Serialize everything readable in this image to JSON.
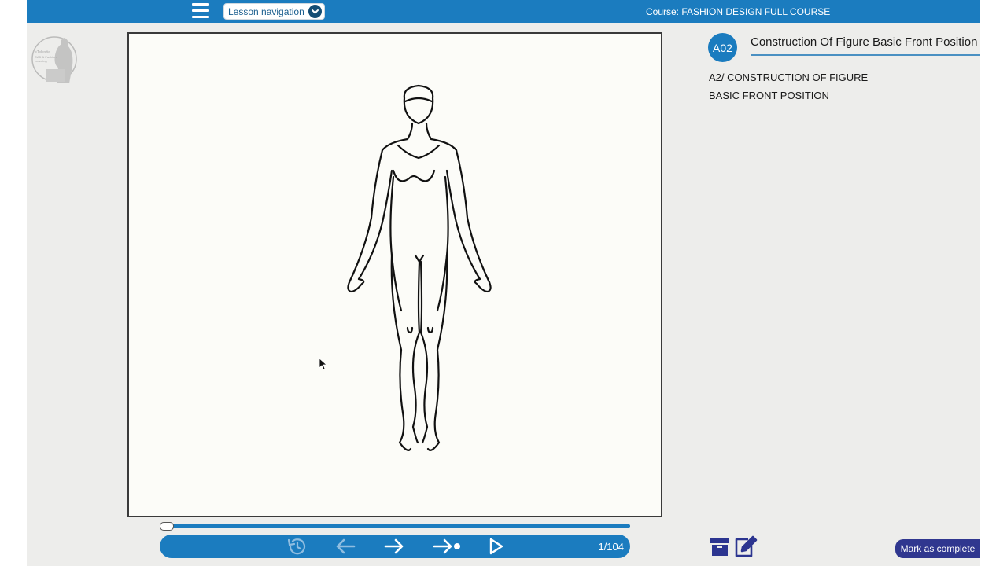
{
  "topbar": {
    "lesson_nav_label": "Lesson navigation",
    "course_title": "Course: FASHION DESIGN FULL COURSE"
  },
  "logo": {
    "text": "eTelestia CAD & Fashion Learning"
  },
  "player": {
    "slide_counter": "1/104",
    "progress": 0.0
  },
  "lesson": {
    "badge": "A02",
    "title": "Construction Of Figure Basic Front Position",
    "description_line1": "A2/ CONSTRUCTION OF FIGURE",
    "description_line2": "BASIC FRONT POSITION"
  },
  "actions": {
    "mark_complete_label": "Mark as complete"
  },
  "icons": {
    "menu": "hamburger-menu-icon",
    "dropdown": "chevron-down-icon",
    "replay": "replay-icon",
    "prev": "arrow-left-icon",
    "next": "arrow-right-icon",
    "skip": "skip-forward-icon",
    "play": "play-icon",
    "box": "box-icon",
    "notes": "edit-note-icon"
  },
  "colors": {
    "brand_blue": "#1b7cbf",
    "mark_complete_bg": "#30378f",
    "app_bg": "#ededeb"
  }
}
